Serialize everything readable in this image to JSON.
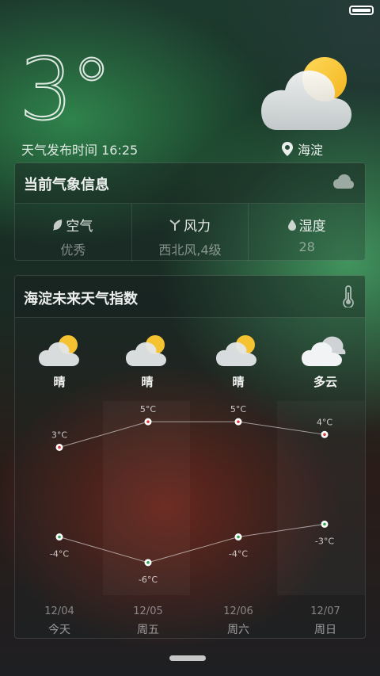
{
  "header": {
    "temperature": "3°",
    "publish_label": "天气发布时间",
    "publish_time": "16:25",
    "location": "海淀"
  },
  "current": {
    "title": "当前气象信息",
    "items": [
      {
        "label": "空气",
        "value": "优秀",
        "icon": "leaf-icon"
      },
      {
        "label": "风力",
        "value": "西北风,4级",
        "icon": "wind-icon"
      },
      {
        "label": "湿度",
        "value": "28",
        "icon": "drop-icon"
      }
    ]
  },
  "forecast": {
    "title": "海淀未来天气指数",
    "days": [
      {
        "condition": "晴",
        "icon": "sunny-cloud-icon",
        "high": "3°C",
        "low": "-4°C",
        "date": "12/04",
        "weekday": "今天"
      },
      {
        "condition": "晴",
        "icon": "sunny-cloud-icon",
        "high": "5°C",
        "low": "-6°C",
        "date": "12/05",
        "weekday": "周五"
      },
      {
        "condition": "晴",
        "icon": "sunny-cloud-icon",
        "high": "5°C",
        "low": "-4°C",
        "date": "12/06",
        "weekday": "周六"
      },
      {
        "condition": "多云",
        "icon": "cloudy-icon",
        "high": "4°C",
        "low": "-3°C",
        "date": "12/07",
        "weekday": "周日"
      }
    ]
  },
  "chart_data": {
    "type": "line",
    "categories": [
      "12/04",
      "12/05",
      "12/06",
      "12/07"
    ],
    "series": [
      {
        "values": [
          3,
          5,
          5,
          4
        ]
      },
      {
        "values": [
          -4,
          -6,
          -4,
          -3
        ]
      }
    ],
    "ylim": [
      -7,
      6
    ]
  }
}
